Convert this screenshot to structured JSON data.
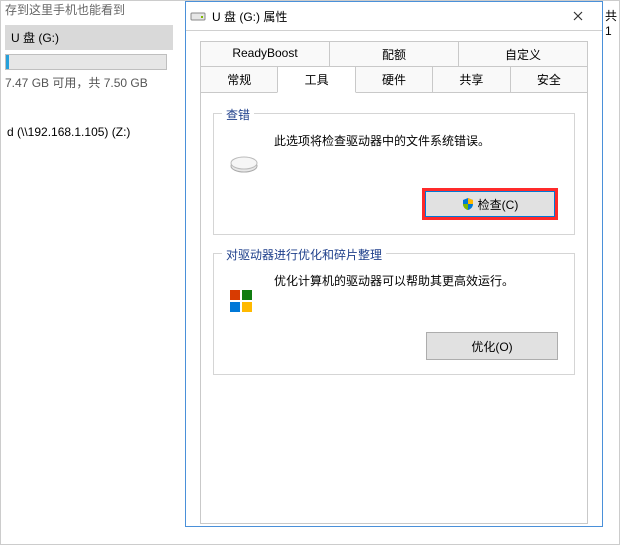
{
  "explorer": {
    "hint": "存到这里手机也能看到",
    "drive": {
      "name": "U 盘 (G:)",
      "stats": "7.47 GB 可用，共 7.50 GB"
    },
    "network_drive": "d (\\\\192.168.1.105) (Z:)"
  },
  "dialog": {
    "title": "U 盘 (G:) 属性",
    "tabs_row1": [
      "ReadyBoost",
      "配额",
      "自定义"
    ],
    "tabs_row2": [
      "常规",
      "工具",
      "硬件",
      "共享",
      "安全"
    ],
    "active_tab": "工具",
    "group_check": {
      "title": "查错",
      "description": "此选项将检查驱动器中的文件系统错误。",
      "button": "检查(C)"
    },
    "group_optimize": {
      "title": "对驱动器进行优化和碎片整理",
      "description": "优化计算机的驱动器可以帮助其更高效运行。",
      "button": "优化(O)"
    }
  },
  "outside_text": "共 1"
}
